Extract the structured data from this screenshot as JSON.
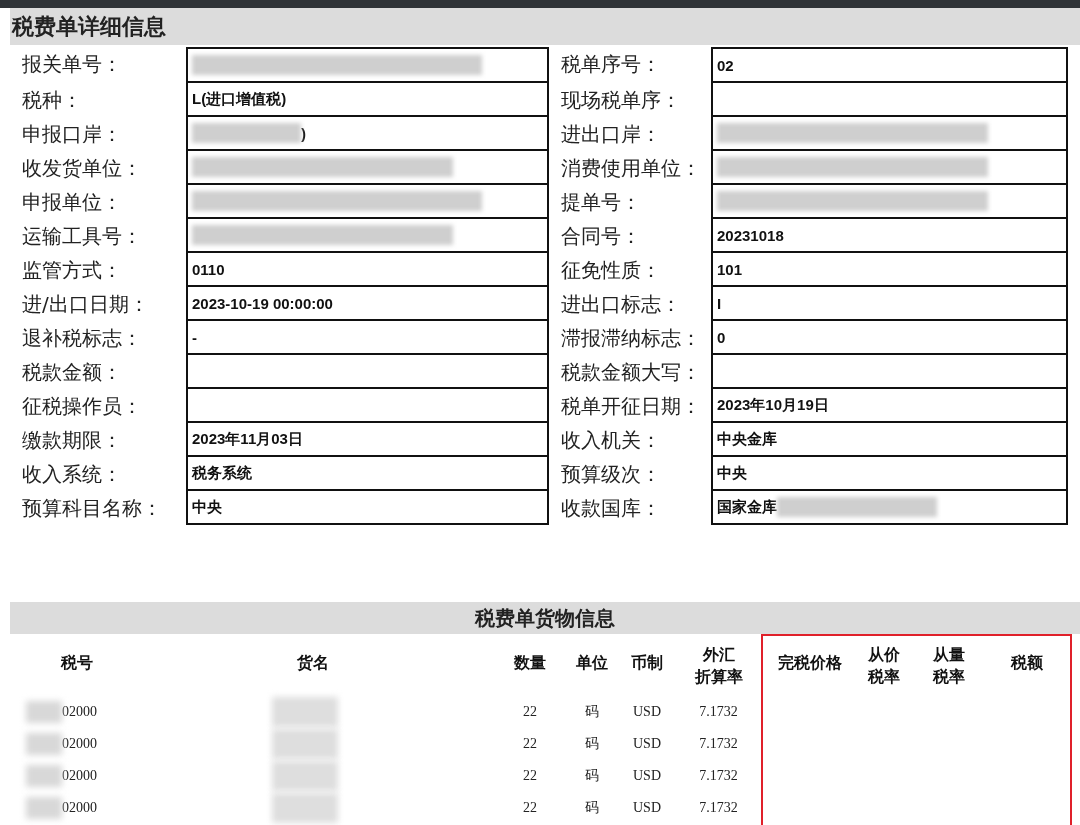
{
  "title": "税费单详细信息",
  "rows": [
    {
      "left": {
        "label": "报关单号：",
        "kind": "blurred"
      },
      "right": {
        "label": "税单序号：",
        "value": "02",
        "kind": "text"
      }
    },
    {
      "left": {
        "label": "税种：",
        "value": "L(进口增值税)",
        "kind": "text"
      },
      "right": {
        "label": "现场税单序：",
        "kind": "text"
      }
    },
    {
      "left": {
        "label": "申报口岸：",
        "value": ")",
        "kind": "blurtext"
      },
      "right": {
        "label": "进出口岸：",
        "kind": "blurred"
      }
    },
    {
      "left": {
        "label": "收发货单位：",
        "kind": "blurred"
      },
      "right": {
        "label": "消费使用单位：",
        "kind": "blurred"
      }
    },
    {
      "left": {
        "label": "申报单位：",
        "kind": "blurred"
      },
      "right": {
        "label": "提单号：",
        "kind": "blurred"
      }
    },
    {
      "left": {
        "label": "运输工具号：",
        "kind": "blurred"
      },
      "right": {
        "label": "合同号：",
        "value": "20231018",
        "kind": "text"
      }
    },
    {
      "left": {
        "label": "监管方式：",
        "value": "0110",
        "kind": "text"
      },
      "right": {
        "label": "征免性质：",
        "value": "101",
        "kind": "text"
      }
    },
    {
      "left": {
        "label": "进/出口日期：",
        "value": "2023-10-19 00:00:00",
        "kind": "text"
      },
      "right": {
        "label": "进出口标志：",
        "value": "I",
        "kind": "text"
      }
    },
    {
      "left": {
        "label": "退补税标志：",
        "value": "-",
        "kind": "text"
      },
      "right": {
        "label": "滞报滞纳标志：",
        "value": "0",
        "kind": "text"
      }
    },
    {
      "left": {
        "label": "税款金额：",
        "kind": "text"
      },
      "right": {
        "label": "税款金额大写：",
        "kind": "text"
      }
    },
    {
      "left": {
        "label": "征税操作员：",
        "kind": "text"
      },
      "right": {
        "label": "税单开征日期：",
        "value": "2023年10月19日",
        "kind": "text"
      }
    },
    {
      "left": {
        "label": "缴款期限：",
        "value": "2023年11月03日",
        "kind": "text"
      },
      "right": {
        "label": "收入机关：",
        "value": "中央金库",
        "kind": "text"
      }
    },
    {
      "left": {
        "label": "收入系统：",
        "value": "税务系统",
        "kind": "text"
      },
      "right": {
        "label": "预算级次：",
        "value": "中央",
        "kind": "text"
      }
    },
    {
      "left": {
        "label": "预算科目名称：",
        "value": "中央",
        "kind": "text"
      },
      "right": {
        "label": "收款国库：",
        "value": "国家金库",
        "kind": "textblur"
      }
    }
  ],
  "goods": {
    "title": "税费单货物信息",
    "columns": [
      {
        "lines": [
          "税号"
        ],
        "highlighted": false
      },
      {
        "lines": [
          "货名"
        ],
        "highlighted": false
      },
      {
        "lines": [
          "数量"
        ],
        "highlighted": false
      },
      {
        "lines": [
          "单位"
        ],
        "highlighted": false
      },
      {
        "lines": [
          "币制"
        ],
        "highlighted": false
      },
      {
        "lines": [
          "外汇",
          "折算率"
        ],
        "highlighted": false
      },
      {
        "lines": [
          "完税价格"
        ],
        "highlighted": true
      },
      {
        "lines": [
          "从价",
          "税率"
        ],
        "highlighted": true
      },
      {
        "lines": [
          "从量",
          "税率"
        ],
        "highlighted": true
      },
      {
        "lines": [
          "税额"
        ],
        "highlighted": true
      }
    ],
    "rows": [
      {
        "tax_code": "02000",
        "code_redacted": true,
        "name_redacted": true,
        "quantity": "22",
        "unit": "码",
        "currency": "USD",
        "rate": "7.1732"
      },
      {
        "tax_code": "02000",
        "code_redacted": true,
        "name_redacted": true,
        "quantity": "22",
        "unit": "码",
        "currency": "USD",
        "rate": "7.1732"
      },
      {
        "tax_code": "02000",
        "code_redacted": true,
        "name_redacted": true,
        "quantity": "22",
        "unit": "码",
        "currency": "USD",
        "rate": "7.1732"
      },
      {
        "tax_code": "02000",
        "code_redacted": true,
        "name_redacted": true,
        "quantity": "22",
        "unit": "码",
        "currency": "USD",
        "rate": "7.1732"
      }
    ]
  }
}
